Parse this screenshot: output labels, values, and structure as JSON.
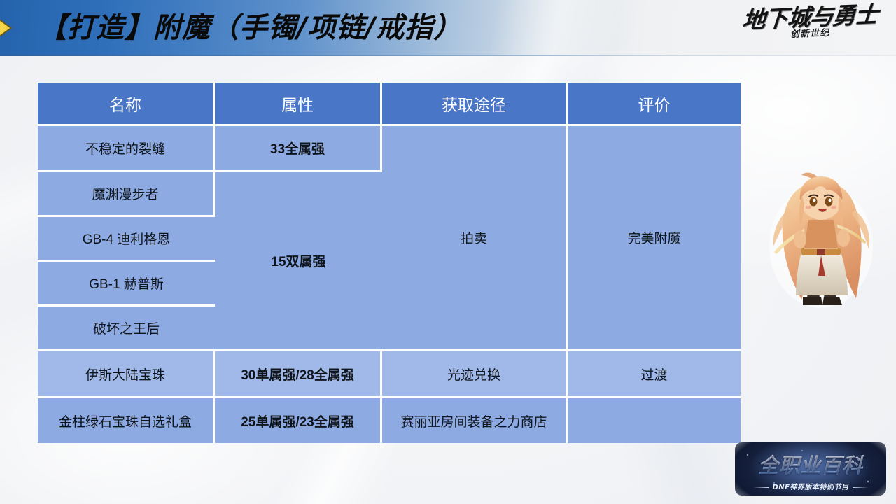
{
  "banner": {
    "title": "【打造】附魔（手镯/项链/戒指）",
    "chevron_icon": "chevron-right-icon",
    "accent_color": "#2563ad",
    "chevron_color": "#f0d33c"
  },
  "game_logo": {
    "main": "地下城与勇士",
    "sub": "创新世纪"
  },
  "show_logo": {
    "main": "全职业百科",
    "sub": "DNF神界版本特别节目"
  },
  "character": {
    "name": "chibi-character",
    "hair_color": "#e8a87a",
    "description": "chibi-archer-avatar"
  },
  "table": {
    "header_color": "#4a76c8",
    "row_color": "#8dabe2",
    "row_alt_color": "#a0b9e8",
    "grid_color": "#ffffff",
    "headers": [
      "名称",
      "属性",
      "获取途径",
      "评价"
    ],
    "rows": [
      {
        "name": "不稳定的裂缝",
        "attr": "33全属强",
        "attr_rowspan": 1,
        "source": "拍卖",
        "source_rowspan": 5,
        "rating": "完美附魔",
        "rating_rowspan": 5,
        "alt": false
      },
      {
        "name": "魔渊漫步者",
        "attr": "15双属强",
        "attr_rowspan": 4,
        "alt": false
      },
      {
        "name": "GB-4 迪利格恩",
        "alt": false
      },
      {
        "name": "GB-1 赫普斯",
        "alt": false
      },
      {
        "name": "破坏之王后",
        "alt": false
      },
      {
        "name": "伊斯大陆宝珠",
        "attr": "30单属强/28全属强",
        "attr_rowspan": 1,
        "source": "光迹兑换",
        "source_rowspan": 1,
        "rating": "过渡",
        "rating_rowspan": 1,
        "alt": true
      },
      {
        "name": "金柱绿石宝珠自选礼盒",
        "attr": "25单属强/23全属强",
        "attr_rowspan": 1,
        "source": "赛丽亚房间装备之力商店",
        "source_rowspan": 1,
        "rating": "",
        "rating_rowspan": 1,
        "alt": false
      }
    ]
  }
}
